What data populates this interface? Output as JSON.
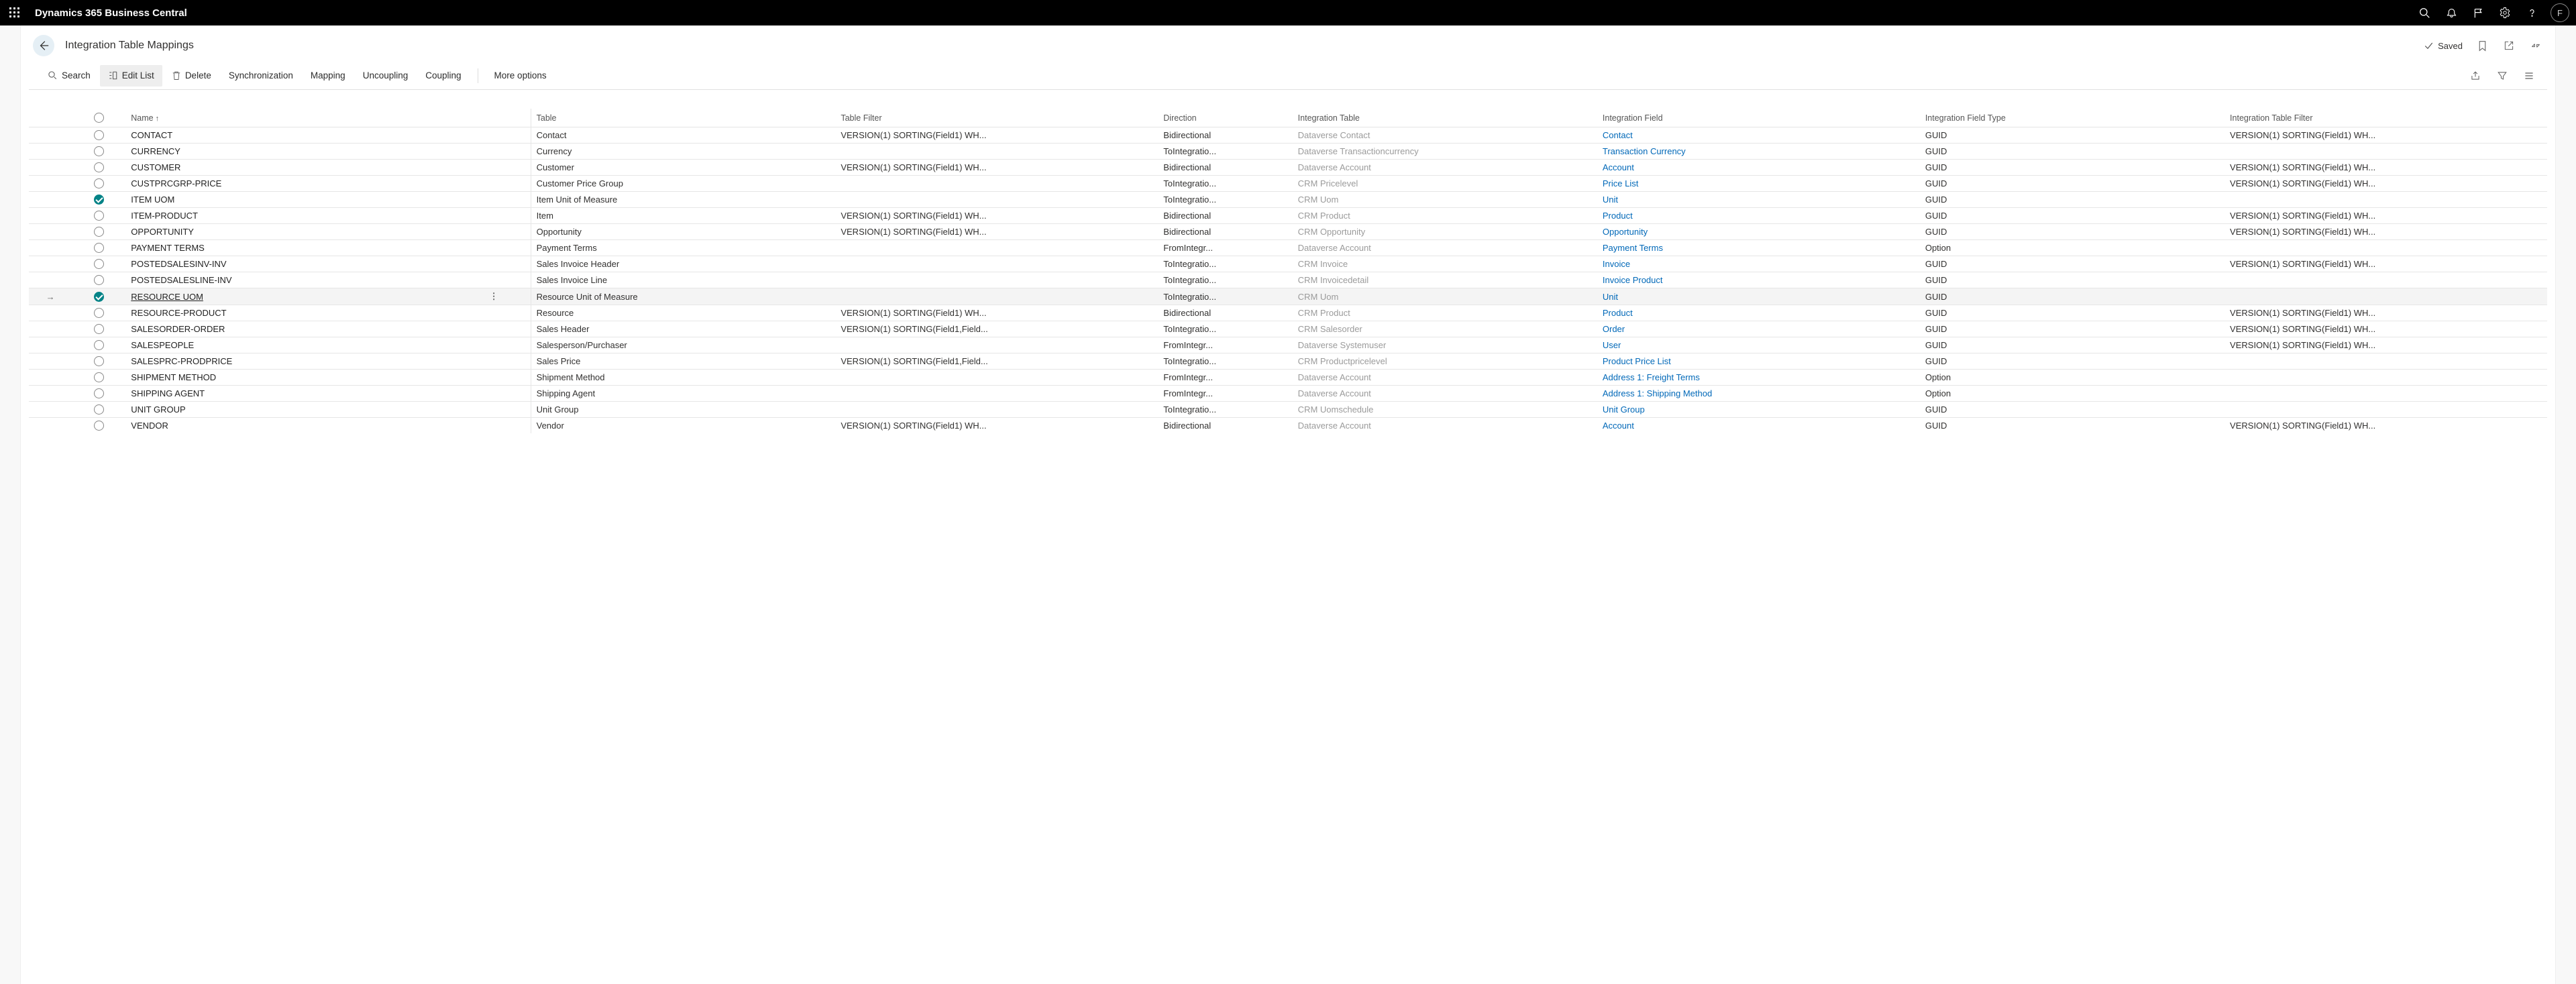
{
  "topbar": {
    "app_title": "Dynamics 365 Business Central",
    "avatar_initial": "F"
  },
  "page": {
    "title": "Integration Table Mappings",
    "saved_label": "Saved"
  },
  "commands": {
    "search": "Search",
    "edit_list": "Edit List",
    "delete": "Delete",
    "synchronization": "Synchronization",
    "mapping": "Mapping",
    "uncoupling": "Uncoupling",
    "coupling": "Coupling",
    "more_options": "More options"
  },
  "columns": {
    "name": "Name",
    "table": "Table",
    "table_filter": "Table Filter",
    "direction": "Direction",
    "integration_table": "Integration Table",
    "integration_field": "Integration Field",
    "integration_field_type": "Integration Field Type",
    "integration_table_filter": "Integration Table Filter"
  },
  "rows": [
    {
      "selected": false,
      "name": "CONTACT",
      "table": "Contact",
      "table_filter": "VERSION(1) SORTING(Field1) WH...",
      "direction": "Bidirectional",
      "int_table": "Dataverse Contact",
      "int_field": "Contact",
      "int_field_type": "GUID",
      "int_table_filter": "VERSION(1) SORTING(Field1) WH..."
    },
    {
      "selected": false,
      "name": "CURRENCY",
      "table": "Currency",
      "table_filter": "",
      "direction": "ToIntegratio...",
      "int_table": "Dataverse Transactioncurrency",
      "int_field": "Transaction Currency",
      "int_field_type": "GUID",
      "int_table_filter": ""
    },
    {
      "selected": false,
      "name": "CUSTOMER",
      "table": "Customer",
      "table_filter": "VERSION(1) SORTING(Field1) WH...",
      "direction": "Bidirectional",
      "int_table": "Dataverse Account",
      "int_field": "Account",
      "int_field_type": "GUID",
      "int_table_filter": "VERSION(1) SORTING(Field1) WH..."
    },
    {
      "selected": false,
      "name": "CUSTPRCGRP-PRICE",
      "table": "Customer Price Group",
      "table_filter": "",
      "direction": "ToIntegratio...",
      "int_table": "CRM Pricelevel",
      "int_field": "Price List",
      "int_field_type": "GUID",
      "int_table_filter": "VERSION(1) SORTING(Field1) WH..."
    },
    {
      "selected": true,
      "name": "ITEM UOM",
      "table": "Item Unit of Measure",
      "table_filter": "",
      "direction": "ToIntegratio...",
      "int_table": "CRM Uom",
      "int_field": "Unit",
      "int_field_type": "GUID",
      "int_table_filter": ""
    },
    {
      "selected": false,
      "name": "ITEM-PRODUCT",
      "table": "Item",
      "table_filter": "VERSION(1) SORTING(Field1) WH...",
      "direction": "Bidirectional",
      "int_table": "CRM Product",
      "int_field": "Product",
      "int_field_type": "GUID",
      "int_table_filter": "VERSION(1) SORTING(Field1) WH..."
    },
    {
      "selected": false,
      "name": "OPPORTUNITY",
      "table": "Opportunity",
      "table_filter": "VERSION(1) SORTING(Field1) WH...",
      "direction": "Bidirectional",
      "int_table": "CRM Opportunity",
      "int_field": "Opportunity",
      "int_field_type": "GUID",
      "int_table_filter": "VERSION(1) SORTING(Field1) WH..."
    },
    {
      "selected": false,
      "name": "PAYMENT TERMS",
      "table": "Payment Terms",
      "table_filter": "",
      "direction": "FromIntegr...",
      "int_table": "Dataverse Account",
      "int_field": "Payment Terms",
      "int_field_type": "Option",
      "int_table_filter": ""
    },
    {
      "selected": false,
      "name": "POSTEDSALESINV-INV",
      "table": "Sales Invoice Header",
      "table_filter": "",
      "direction": "ToIntegratio...",
      "int_table": "CRM Invoice",
      "int_field": "Invoice",
      "int_field_type": "GUID",
      "int_table_filter": "VERSION(1) SORTING(Field1) WH..."
    },
    {
      "selected": false,
      "name": "POSTEDSALESLINE-INV",
      "table": "Sales Invoice Line",
      "table_filter": "",
      "direction": "ToIntegratio...",
      "int_table": "CRM Invoicedetail",
      "int_field": "Invoice Product",
      "int_field_type": "GUID",
      "int_table_filter": ""
    },
    {
      "selected": true,
      "current": true,
      "name": "RESOURCE UOM",
      "table": "Resource Unit of Measure",
      "table_filter": "",
      "direction": "ToIntegratio...",
      "int_table": "CRM Uom",
      "int_field": "Unit",
      "int_field_type": "GUID",
      "int_table_filter": ""
    },
    {
      "selected": false,
      "name": "RESOURCE-PRODUCT",
      "table": "Resource",
      "table_filter": "VERSION(1) SORTING(Field1) WH...",
      "direction": "Bidirectional",
      "int_table": "CRM Product",
      "int_field": "Product",
      "int_field_type": "GUID",
      "int_table_filter": "VERSION(1) SORTING(Field1) WH..."
    },
    {
      "selected": false,
      "name": "SALESORDER-ORDER",
      "table": "Sales Header",
      "table_filter": "VERSION(1) SORTING(Field1,Field...",
      "direction": "ToIntegratio...",
      "int_table": "CRM Salesorder",
      "int_field": "Order",
      "int_field_type": "GUID",
      "int_table_filter": "VERSION(1) SORTING(Field1) WH..."
    },
    {
      "selected": false,
      "name": "SALESPEOPLE",
      "table": "Salesperson/Purchaser",
      "table_filter": "",
      "direction": "FromIntegr...",
      "int_table": "Dataverse Systemuser",
      "int_field": "User",
      "int_field_type": "GUID",
      "int_table_filter": "VERSION(1) SORTING(Field1) WH..."
    },
    {
      "selected": false,
      "name": "SALESPRC-PRODPRICE",
      "table": "Sales Price",
      "table_filter": "VERSION(1) SORTING(Field1,Field...",
      "direction": "ToIntegratio...",
      "int_table": "CRM Productpricelevel",
      "int_field": "Product Price List",
      "int_field_type": "GUID",
      "int_table_filter": ""
    },
    {
      "selected": false,
      "name": "SHIPMENT METHOD",
      "table": "Shipment Method",
      "table_filter": "",
      "direction": "FromIntegr...",
      "int_table": "Dataverse Account",
      "int_field": "Address 1: Freight Terms",
      "int_field_type": "Option",
      "int_table_filter": ""
    },
    {
      "selected": false,
      "name": "SHIPPING AGENT",
      "table": "Shipping Agent",
      "table_filter": "",
      "direction": "FromIntegr...",
      "int_table": "Dataverse Account",
      "int_field": "Address 1: Shipping Method",
      "int_field_type": "Option",
      "int_table_filter": ""
    },
    {
      "selected": false,
      "name": "UNIT GROUP",
      "table": "Unit Group",
      "table_filter": "",
      "direction": "ToIntegratio...",
      "int_table": "CRM Uomschedule",
      "int_field": "Unit Group",
      "int_field_type": "GUID",
      "int_table_filter": ""
    },
    {
      "selected": false,
      "name": "VENDOR",
      "table": "Vendor",
      "table_filter": "VERSION(1) SORTING(Field1) WH...",
      "direction": "Bidirectional",
      "int_table": "Dataverse Account",
      "int_field": "Account",
      "int_field_type": "GUID",
      "int_table_filter": "VERSION(1) SORTING(Field1) WH..."
    }
  ]
}
